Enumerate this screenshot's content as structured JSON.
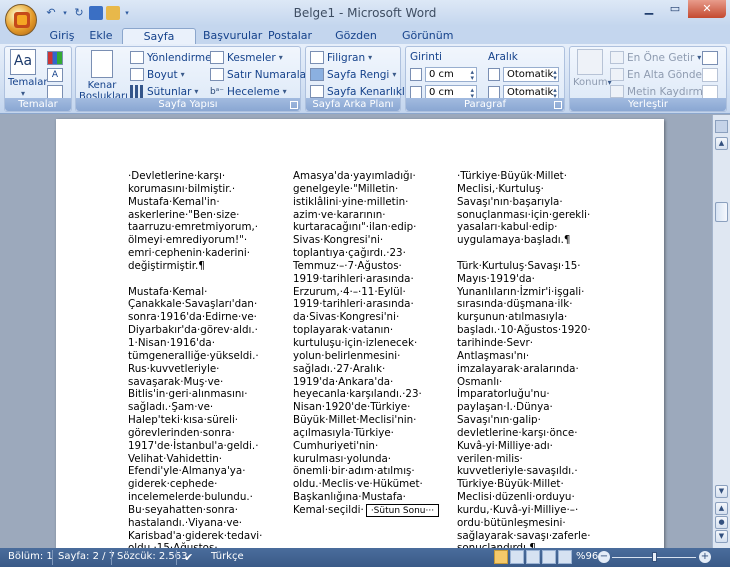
{
  "window": {
    "title": "Belge1 - Microsoft Word"
  },
  "tabs": [
    {
      "label": "Giriş"
    },
    {
      "label": "Ekle"
    },
    {
      "label": "Sayfa Düzeni"
    },
    {
      "label": "Başvurular"
    },
    {
      "label": "Postalar"
    },
    {
      "label": "Gözden Geçir"
    },
    {
      "label": "Görünüm"
    }
  ],
  "ribbon": {
    "temalar": {
      "group": "Temalar",
      "button": "Temalar"
    },
    "sayfa_yapisi": {
      "group": "Sayfa Yapısı",
      "kenar": "Kenar",
      "bosluklari": "Boşlukları",
      "yonlendirme": "Yönlendirme",
      "boyut": "Boyut",
      "sutunlar": "Sütunlar",
      "kesmeler": "Kesmeler",
      "satir_numaralari": "Satır Numaraları",
      "heceleme": "Heceleme"
    },
    "sayfa_arka_plani": {
      "group": "Sayfa Arka Planı",
      "filigran": "Filigran",
      "sayfa_rengi": "Sayfa Rengi",
      "sayfa_kenarliklari": "Sayfa Kenarlıkları"
    },
    "paragraf": {
      "group": "Paragraf",
      "girinti": "Girinti",
      "aralik": "Aralık",
      "girinti_sol": "0 cm",
      "girinti_sag": "0 cm",
      "aralik_once": "Otomatik",
      "aralik_sonra": "Otomatik"
    },
    "yerlestir": {
      "group": "Yerleştir",
      "konum": "Konum",
      "en_one": "En Öne Getir",
      "en_alta": "En Alta Gönder",
      "metin_kaydirma": "Metin Kaydırma"
    }
  },
  "document": {
    "columns": [
      [
        "·Devletlerine·karşı·",
        "korumasını·bilmiştir.·",
        "Mustafa·Kemal'in·",
        "askerlerine·\"Ben·size·",
        "taarruzu·emretmiyorum,·",
        "ölmeyi·emrediyorum!\"·",
        "emri·cephenin·kaderini·",
        "değiştirmiştir.¶",
        "",
        "Mustafa·Kemal·",
        "Çanakkale·Savaşları'dan·",
        "sonra·1916'da·Edirne·ve·",
        "Diyarbakır'da·görev·aldı.·",
        "1·Nisan·1916'da·",
        "tümgeneralliğe·yükseldi.·",
        "Rus·kuvvetleriyle·",
        "savaşarak·Muş·ve·",
        "Bitlis'in·geri·alınmasını·",
        "sağladı.·Şam·ve·",
        "Halep'teki·kısa·süreli·",
        "görevlerinden·sonra·",
        "1917'de·İstanbul'a·geldi.·",
        "Velihat·Vahidettin·",
        "Efendi'yle·Almanya'ya·",
        "giderek·cephede·",
        "incelemelerde·bulundu.·",
        "Bu·seyahatten·sonra·",
        "hastalandı.·Viyana·ve·",
        "Karisbad'a·giderek·tedavi·",
        "oldu.·15·Ağustos·",
        "1918'de·Halep'e·7.·Ordu·"
      ],
      [
        "Amasya'da·yayımladığı·",
        "genelgeyle·\"Milletin·",
        "istiklâlini·yine·milletin·",
        "azim·ve·kararının·",
        "kurtaracağını\"·ilan·edip·",
        "Sivas·Kongresi'ni·",
        "toplantıya·çağırdı.·23·",
        "Temmuz·–·7·Ağustos·",
        "1919·tarihleri·arasında·",
        "Erzurum,·4·–·11·Eylül·",
        "1919·tarihleri·arasında·",
        "da·Sivas·Kongresi'ni·",
        "toplayarak·vatanın·",
        "kurtuluşu·için·izlenecek·",
        "yolun·belirlenmesini·",
        "sağladı.·27·Aralık·",
        "1919'da·Ankara'da·",
        "heyecanla·karşılandı.·23·",
        "Nisan·1920'de·Türkiye·",
        "Büyük·Millet·Meclisi'nin·",
        "açılmasıyla·Türkiye·",
        "Cumhuriyeti'nin·",
        "kurulması·yolunda·",
        "önemli·bir·adım·atılmış·",
        "oldu.·Meclis·ve·Hükümet·",
        "Başkanlığına·Mustafa·",
        "Kemal·seçildi·"
      ],
      [
        "·Türkiye·Büyük·Millet·",
        "Meclisi,·Kurtuluş·",
        "Savaşı'nın·başarıyla·",
        "sonuçlanması·için·gerekli·",
        "yasaları·kabul·edip·",
        "uygulamaya·başladı.¶",
        "",
        "Türk·Kurtuluş·Savaşı·15·",
        "Mayıs·1919'da·",
        "Yunanlıların·İzmir'i·işgali·",
        "sırasında·düşmana·ilk·",
        "kurşunun·atılmasıyla·",
        "başladı.·10·Ağustos·1920·",
        "tarihinde·Sevr·",
        "Antlaşması'nı·",
        "imzalayarak·aralarında·",
        "Osmanlı·",
        "İmparatorluğu'nu·",
        "paylaşan·I.·Dünya·",
        "Savaşı'nın·galip·",
        "devletlerine·karşı·önce·",
        "Kuvâ-yi·Milliye·adı·",
        "verilen·milis·",
        "kuvvetleriyle·savaşıldı.·",
        "Türkiye·Büyük·Millet·",
        "Meclisi·düzenli·orduyu·",
        "kurdu,·Kuvâ-yi·Milliye·–·",
        "ordu·bütünleşmesini·",
        "sağlayarak·savaşı·zaferle·",
        "sonuçlandırdı.¶"
      ]
    ],
    "column_break": "·Sütun Sonu···"
  },
  "status": {
    "bolum": "Bölüm: 1",
    "sayfa": "Sayfa: 2 / 7",
    "sozcuk": "Sözcük: 2.563",
    "dil": "Türkçe",
    "zoom": "%96"
  }
}
